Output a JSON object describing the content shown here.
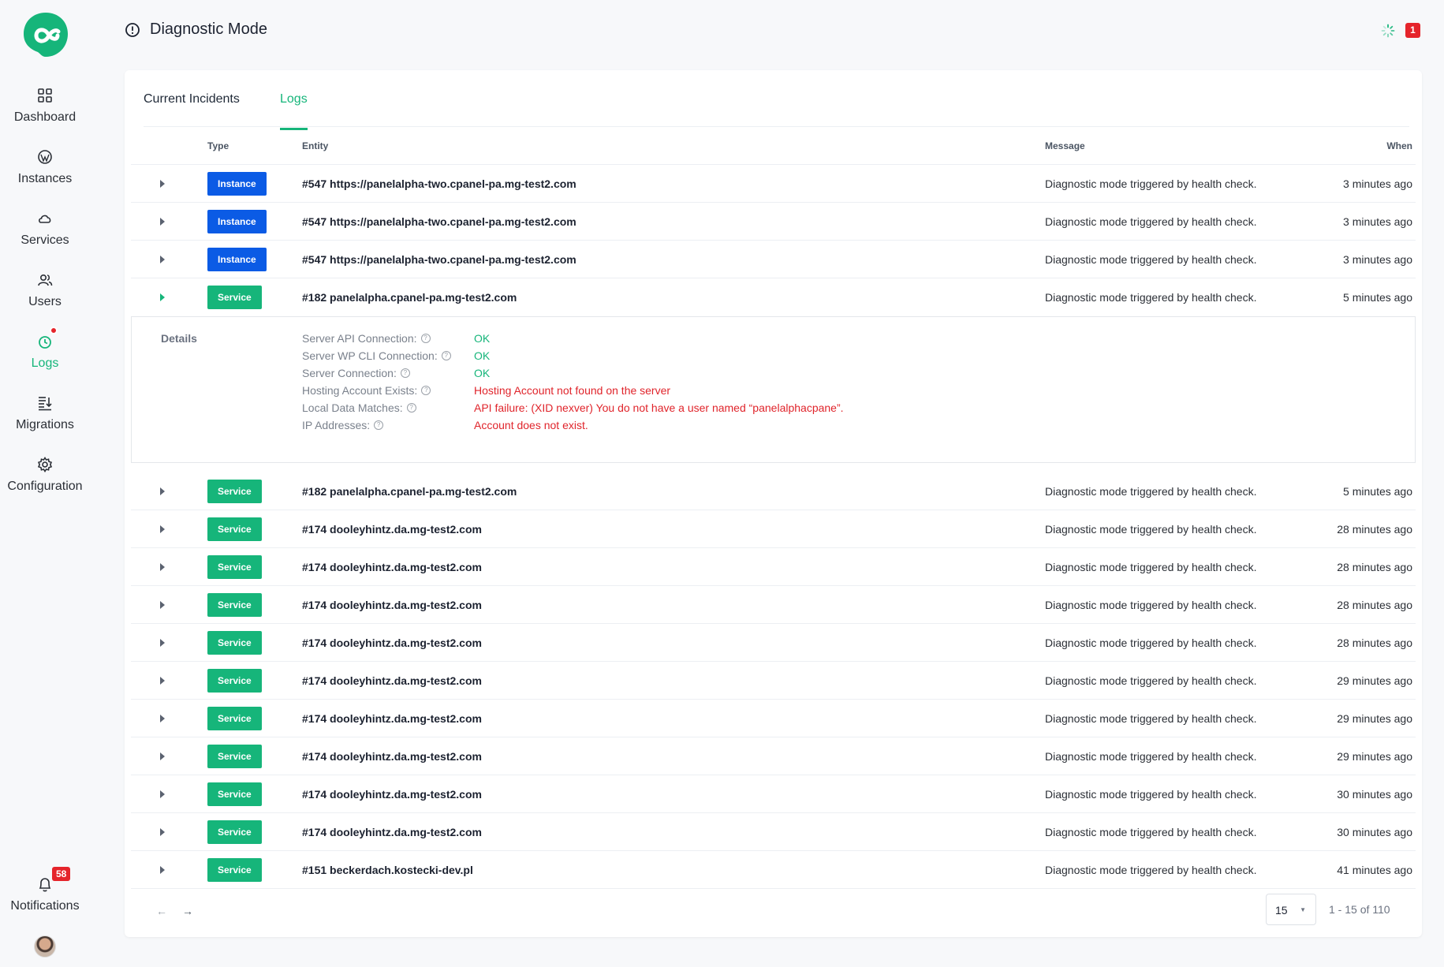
{
  "colors": {
    "accent": "#16b57a",
    "instance": "#0b5be5",
    "error": "#e0242b",
    "badge": "#e5242b"
  },
  "sidebar": {
    "items": [
      {
        "label": "Dashboard",
        "icon": "grid-icon"
      },
      {
        "label": "Instances",
        "icon": "wordpress-icon"
      },
      {
        "label": "Services",
        "icon": "cloud-icon"
      },
      {
        "label": "Users",
        "icon": "users-icon"
      },
      {
        "label": "Logs",
        "icon": "clock-icon"
      },
      {
        "label": "Migrations",
        "icon": "migrate-icon"
      },
      {
        "label": "Configuration",
        "icon": "gear-icon"
      }
    ],
    "notifications": {
      "label": "Notifications",
      "count": "58"
    }
  },
  "header": {
    "title": "Diagnostic Mode",
    "alert_count": "1"
  },
  "tabs": [
    {
      "label": "Current Incidents"
    },
    {
      "label": "Logs"
    }
  ],
  "table": {
    "headers": {
      "type": "Type",
      "entity": "Entity",
      "message": "Message",
      "when": "When"
    },
    "rows": [
      {
        "type": "Instance",
        "entity": "#547 https://panelalpha-two.cpanel-pa.mg-test2.com",
        "message": "Diagnostic mode triggered by health check.",
        "when": "3 minutes ago"
      },
      {
        "type": "Instance",
        "entity": "#547 https://panelalpha-two.cpanel-pa.mg-test2.com",
        "message": "Diagnostic mode triggered by health check.",
        "when": "3 minutes ago"
      },
      {
        "type": "Instance",
        "entity": "#547 https://panelalpha-two.cpanel-pa.mg-test2.com",
        "message": "Diagnostic mode triggered by health check.",
        "when": "3 minutes ago"
      },
      {
        "type": "Service",
        "entity": "#182 panelalpha.cpanel-pa.mg-test2.com",
        "message": "Diagnostic mode triggered by health check.",
        "when": "5 minutes ago"
      },
      {
        "type": "Service",
        "entity": "#182 panelalpha.cpanel-pa.mg-test2.com",
        "message": "Diagnostic mode triggered by health check.",
        "when": "5 minutes ago"
      },
      {
        "type": "Service",
        "entity": "#174 dooleyhintz.da.mg-test2.com",
        "message": "Diagnostic mode triggered by health check.",
        "when": "28 minutes ago"
      },
      {
        "type": "Service",
        "entity": "#174 dooleyhintz.da.mg-test2.com",
        "message": "Diagnostic mode triggered by health check.",
        "when": "28 minutes ago"
      },
      {
        "type": "Service",
        "entity": "#174 dooleyhintz.da.mg-test2.com",
        "message": "Diagnostic mode triggered by health check.",
        "when": "28 minutes ago"
      },
      {
        "type": "Service",
        "entity": "#174 dooleyhintz.da.mg-test2.com",
        "message": "Diagnostic mode triggered by health check.",
        "when": "28 minutes ago"
      },
      {
        "type": "Service",
        "entity": "#174 dooleyhintz.da.mg-test2.com",
        "message": "Diagnostic mode triggered by health check.",
        "when": "29 minutes ago"
      },
      {
        "type": "Service",
        "entity": "#174 dooleyhintz.da.mg-test2.com",
        "message": "Diagnostic mode triggered by health check.",
        "when": "29 minutes ago"
      },
      {
        "type": "Service",
        "entity": "#174 dooleyhintz.da.mg-test2.com",
        "message": "Diagnostic mode triggered by health check.",
        "when": "29 minutes ago"
      },
      {
        "type": "Service",
        "entity": "#174 dooleyhintz.da.mg-test2.com",
        "message": "Diagnostic mode triggered by health check.",
        "when": "30 minutes ago"
      },
      {
        "type": "Service",
        "entity": "#174 dooleyhintz.da.mg-test2.com",
        "message": "Diagnostic mode triggered by health check.",
        "when": "30 minutes ago"
      },
      {
        "type": "Service",
        "entity": "#151 beckerdach.kostecki-dev.pl",
        "message": "Diagnostic mode triggered by health check.",
        "when": "41 minutes ago"
      }
    ],
    "details": {
      "heading": "Details",
      "items": [
        {
          "key": "Server API Connection:",
          "value": "OK",
          "status": "ok"
        },
        {
          "key": "Server WP CLI Connection:",
          "value": "OK",
          "status": "ok"
        },
        {
          "key": "Server Connection:",
          "value": "OK",
          "status": "ok"
        },
        {
          "key": "Hosting Account Exists:",
          "value": "Hosting Account not found on the server",
          "status": "err"
        },
        {
          "key": "Local Data Matches:",
          "value": "API failure: (XID nexver) You do not have a user named “panelalphacpane”.",
          "status": "err"
        },
        {
          "key": "IP Addresses:",
          "value": "Account does not exist.",
          "status": "err"
        }
      ]
    }
  },
  "pagination": {
    "per_page": "15",
    "range": "1 - 15 of 110"
  }
}
